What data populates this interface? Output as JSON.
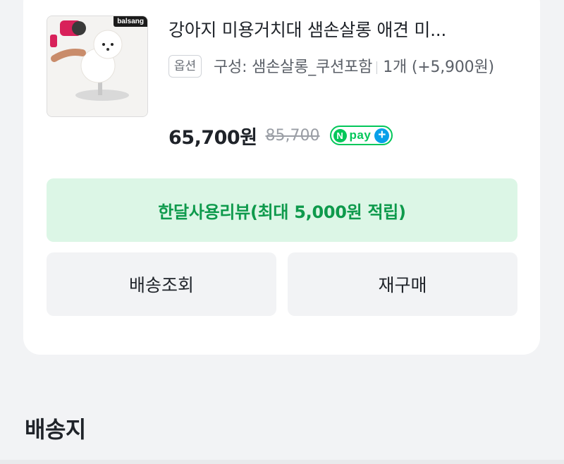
{
  "product": {
    "brand_tag": "balsang",
    "title": "강아지 미용거치대 샘손살롱 애견 미...",
    "option_badge": "옵션",
    "option_text": "구성: 샘손살롱_쿠션포함",
    "option_qty": "1개 (+5,900원)",
    "price": "65,700원",
    "original_price": "85,700"
  },
  "npay": {
    "n": "N",
    "pay": "pay",
    "plus": "+"
  },
  "actions": {
    "review_label": "한달사용리뷰(최대 5,000원 적립)",
    "shipping_label": "배송조회",
    "rebuy_label": "재구매"
  },
  "section": {
    "title": "배송지"
  },
  "colors": {
    "accent_green": "#03c75a",
    "review_bg": "#dcf6e6",
    "review_text": "#0e9a4c"
  }
}
